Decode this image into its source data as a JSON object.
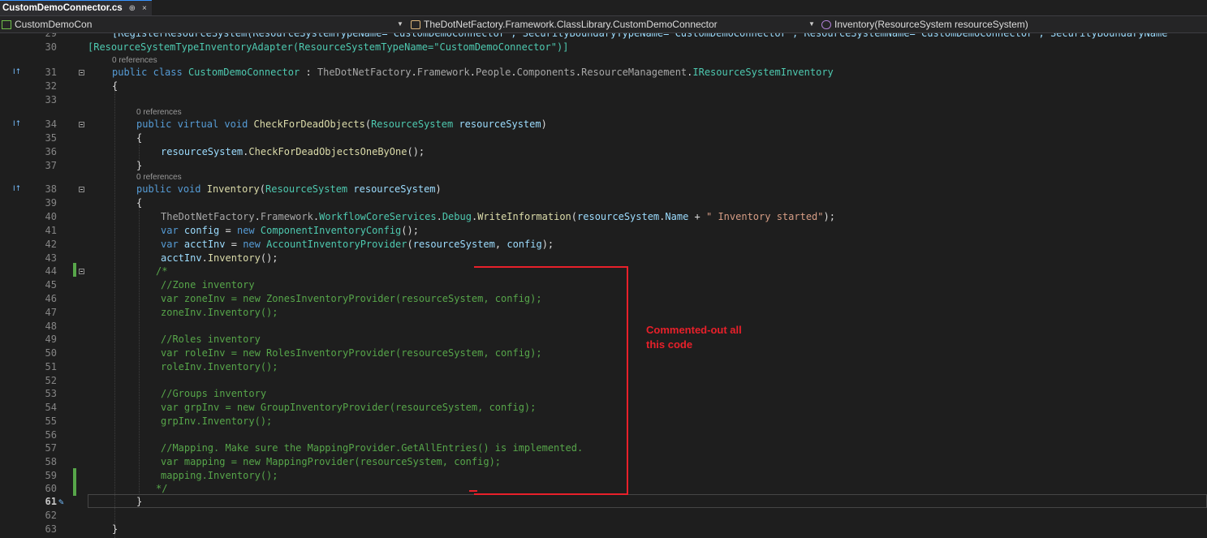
{
  "tab": {
    "filename": "CustomDemoConnector.cs",
    "pin": "⊕",
    "close": "×"
  },
  "navbar": {
    "project": "CustomDemoCon",
    "class_path": "TheDotNetFactory.Framework.ClassLibrary.CustomDemoConnector",
    "member": "Inventory(ResourceSystem resourceSystem)"
  },
  "references": [
    "0 references",
    "0 references",
    "0 references",
    "0 references"
  ],
  "annotation": {
    "line1": "Commented-out all",
    "line2": "this code"
  },
  "lines": [
    {
      "n": "29",
      "t": "[RegisterResourceSystem(ResourceSystemTypeName=\"CustomDemoConnector\", SecurityBoundaryTypeName=\"CustomDemoConnector\", ResourceSystemName=\"CustomDemoConnector\", SecurityBoundaryName"
    },
    {
      "n": "30",
      "t": "[ResourceSystemTypeInventoryAdapter(ResourceSystemTypeName=\"CustomDemoConnector\")]"
    },
    {
      "n": "31",
      "t": "public class CustomDemoConnector : TheDotNetFactory.Framework.People.Components.ResourceManagement.IResourceSystemInventory"
    },
    {
      "n": "32",
      "t": "{"
    },
    {
      "n": "33",
      "t": ""
    },
    {
      "n": "34",
      "t": "public virtual void CheckForDeadObjects(ResourceSystem resourceSystem)"
    },
    {
      "n": "35",
      "t": "{"
    },
    {
      "n": "36",
      "t": "resourceSystem.CheckForDeadObjectsOneByOne();"
    },
    {
      "n": "37",
      "t": "}"
    },
    {
      "n": "38",
      "t": "public void Inventory(ResourceSystem resourceSystem)"
    },
    {
      "n": "39",
      "t": "{"
    },
    {
      "n": "40",
      "t": "TheDotNetFactory.Framework.WorkflowCoreServices.Debug.WriteInformation(resourceSystem.Name + \" Inventory started\");"
    },
    {
      "n": "41",
      "t": "var config = new ComponentInventoryConfig();"
    },
    {
      "n": "42",
      "t": "var acctInv = new AccountInventoryProvider(resourceSystem, config);"
    },
    {
      "n": "43",
      "t": "acctInv.Inventory();"
    },
    {
      "n": "44",
      "t": "/*"
    },
    {
      "n": "45",
      "t": "//Zone inventory"
    },
    {
      "n": "46",
      "t": "var zoneInv = new ZonesInventoryProvider(resourceSystem, config);"
    },
    {
      "n": "47",
      "t": "zoneInv.Inventory();"
    },
    {
      "n": "48",
      "t": ""
    },
    {
      "n": "49",
      "t": "//Roles inventory"
    },
    {
      "n": "50",
      "t": "var roleInv = new RolesInventoryProvider(resourceSystem, config);"
    },
    {
      "n": "51",
      "t": "roleInv.Inventory();"
    },
    {
      "n": "52",
      "t": ""
    },
    {
      "n": "53",
      "t": "//Groups inventory"
    },
    {
      "n": "54",
      "t": "var grpInv = new GroupInventoryProvider(resourceSystem, config);"
    },
    {
      "n": "55",
      "t": "grpInv.Inventory();"
    },
    {
      "n": "56",
      "t": ""
    },
    {
      "n": "57",
      "t": "//Mapping. Make sure the MappingProvider.GetAllEntries() is implemented."
    },
    {
      "n": "58",
      "t": "var mapping = new MappingProvider(resourceSystem, config);"
    },
    {
      "n": "59",
      "t": "mapping.Inventory();"
    },
    {
      "n": "60",
      "t": "*/"
    },
    {
      "n": "61",
      "t": "}"
    },
    {
      "n": "62",
      "t": ""
    },
    {
      "n": "63",
      "t": "}"
    }
  ]
}
